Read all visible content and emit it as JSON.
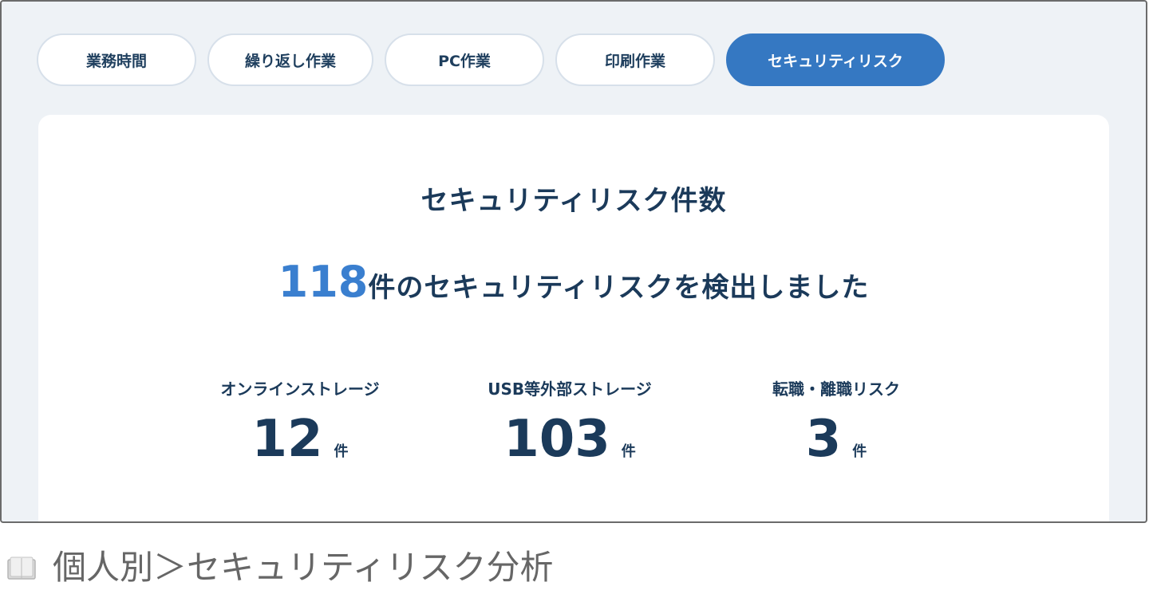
{
  "tabs": [
    {
      "label": "業務時間",
      "active": false
    },
    {
      "label": "繰り返し作業",
      "active": false
    },
    {
      "label": "PC作業",
      "active": false
    },
    {
      "label": "印刷作業",
      "active": false
    },
    {
      "label": "セキュリティリスク",
      "active": true
    }
  ],
  "card": {
    "title": "セキュリティリスク件数",
    "headline_count": "118",
    "headline_text": "件のセキュリティリスクを検出しました",
    "stats": [
      {
        "label": "オンラインストレージ",
        "value": "12",
        "unit": "件"
      },
      {
        "label": "USB等外部ストレージ",
        "value": "103",
        "unit": "件"
      },
      {
        "label": "転職・離職リスク",
        "value": "3",
        "unit": "件"
      }
    ]
  },
  "caption": {
    "icon": "book-icon",
    "text": "個人別＞セキュリティリスク分析"
  },
  "colors": {
    "accent": "#3578c2",
    "count_blue": "#3a7fcf",
    "navy_text": "#1b3a5a",
    "panel_bg": "#eef2f6"
  }
}
